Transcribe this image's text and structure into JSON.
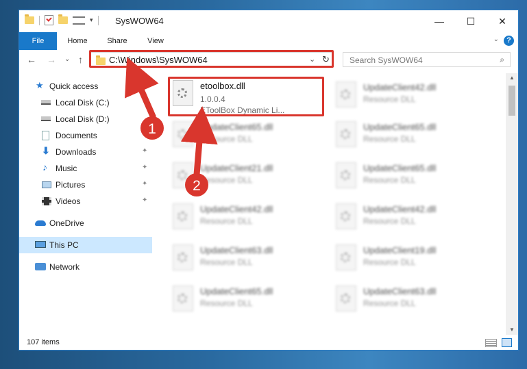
{
  "window": {
    "title": "SysWOW64",
    "controls": {
      "minimize": "—",
      "maximize": "☐",
      "close": "✕"
    }
  },
  "ribbon": {
    "tabs": [
      "File",
      "Home",
      "Share",
      "View"
    ],
    "help": "?",
    "collapse": "⌄"
  },
  "nav": {
    "back": "←",
    "forward": "→",
    "recent": "⌄",
    "up": "↑",
    "address": "C:\\Windows\\SysWOW64",
    "address_dropdown": "⌄",
    "refresh": "↻",
    "search_placeholder": "Search SysWOW64",
    "search_icon": "⌕"
  },
  "sidebar": {
    "items": [
      {
        "label": "Quick access",
        "icon": "star-icon"
      },
      {
        "label": "Local Disk (C:)",
        "icon": "drive-icon"
      },
      {
        "label": "Local Disk (D:)",
        "icon": "drive-icon"
      },
      {
        "label": "Documents",
        "icon": "documents-icon"
      },
      {
        "label": "Downloads",
        "icon": "download-icon"
      },
      {
        "label": "Music",
        "icon": "music-icon"
      },
      {
        "label": "Pictures",
        "icon": "pictures-icon"
      },
      {
        "label": "Videos",
        "icon": "videos-icon"
      },
      {
        "label": "OneDrive",
        "icon": "cloud-icon"
      },
      {
        "label": "This PC",
        "icon": "computer-icon"
      },
      {
        "label": "Network",
        "icon": "network-icon"
      }
    ],
    "pin": "✦"
  },
  "files": {
    "highlight": {
      "name": "etoolbox.dll",
      "version": "1.0.0.4",
      "description": "EToolBox Dynamic Li..."
    },
    "left_column": [
      {
        "name": "UpdateClient65.dll",
        "desc": "Resource DLL"
      },
      {
        "name": "UpdateClient21.dll",
        "desc": "Resource DLL"
      },
      {
        "name": "UpdateClient42.dll",
        "desc": "Resource DLL"
      },
      {
        "name": "UpdateClient63.dll",
        "desc": "Resource DLL"
      },
      {
        "name": "UpdateClient65.dll",
        "desc": "Resource DLL"
      }
    ],
    "right_column": [
      {
        "name": "UpdateClient42.dll",
        "desc": "Resource DLL"
      },
      {
        "name": "UpdateClient65.dll",
        "desc": "Resource DLL"
      },
      {
        "name": "UpdateClient65.dll",
        "desc": "Resource DLL"
      },
      {
        "name": "UpdateClient42.dll",
        "desc": "Resource DLL"
      },
      {
        "name": "UpdateClient19.dll",
        "desc": "Resource DLL"
      },
      {
        "name": "UpdateClient63.dll",
        "desc": "Resource DLL"
      }
    ]
  },
  "status": {
    "count": "107 items"
  },
  "annotations": {
    "step1": "1",
    "step2": "2",
    "color": "#d9362d"
  }
}
